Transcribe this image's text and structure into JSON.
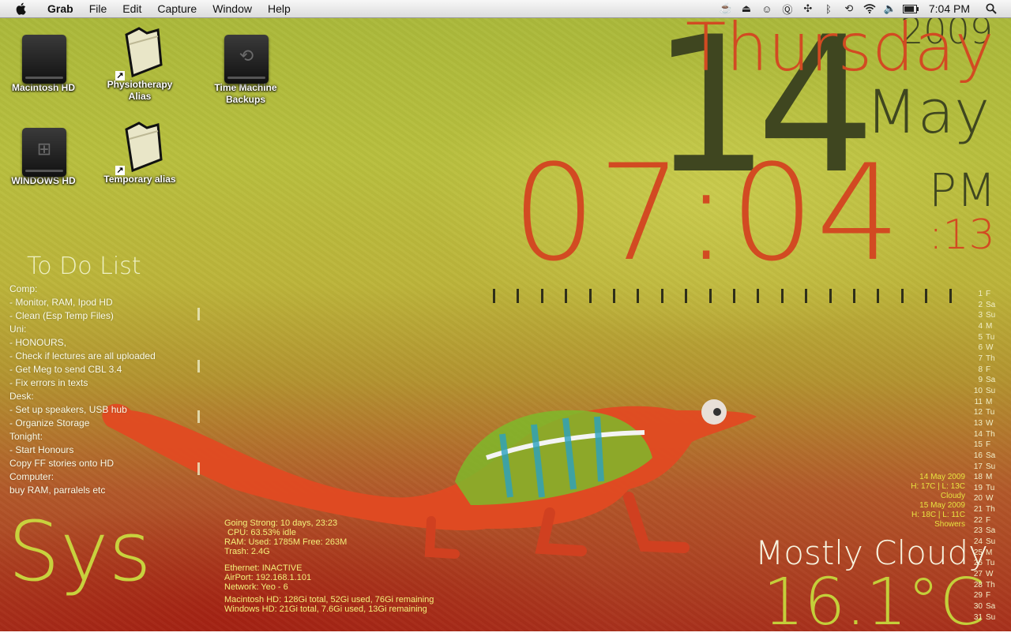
{
  "menubar": {
    "app_name": "Grab",
    "menus": [
      "File",
      "Edit",
      "Capture",
      "Window",
      "Help"
    ],
    "status_icons": [
      "coffee-cup-icon",
      "eject-icon",
      "finder-face-icon",
      "quicksilver-icon",
      "cross-arrows-icon",
      "bluetooth-like-icon",
      "time-machine-icon",
      "wifi-icon",
      "volume-icon",
      "battery-icon"
    ],
    "clock": "7:04 PM"
  },
  "desktop_icons": [
    {
      "label": "Macintosh HD",
      "kind": "drive",
      "emblem": ""
    },
    {
      "label": "Physiotherapy Alias",
      "kind": "folder-alias"
    },
    {
      "label": "Time Machine Backups",
      "kind": "drive",
      "emblem": "⟲"
    },
    {
      "label": "WINDOWS HD",
      "kind": "drive",
      "emblem": "⊞"
    },
    {
      "label": "Temporary alias",
      "kind": "folder-alias"
    }
  ],
  "clock_widget": {
    "day_number": "14",
    "weekday": "Thursday",
    "year": "2009",
    "month": "May",
    "time": "07:04",
    "ampm": "PM",
    "seconds": ":13"
  },
  "todo": {
    "title": "To Do List",
    "lines": [
      "Comp:",
      "- Monitor, RAM, Ipod HD",
      "- Clean (Esp Temp Files)",
      "Uni:",
      "- HONOURS,",
      "- Check if lectures are all uploaded",
      "- Get Meg to send CBL 3.4",
      "- Fix errors in texts",
      "Desk:",
      "- Set up speakers, USB hub",
      "- Organize Storage",
      "Tonight:",
      "- Start Honours",
      "Copy FF stories onto HD",
      "Computer:",
      "buy RAM, parralels etc"
    ]
  },
  "sys": {
    "title": "Sys",
    "uptime": "Going Strong: 10 days, 23:23",
    "cpu": "CPU:  63.53% idle",
    "ram": "RAM:  Used: 1785M Free: 263M",
    "trash": "Trash: 2.4G",
    "ethernet": "Ethernet: INACTIVE",
    "airport": "AirPort: 192.168.1.101",
    "network": "Network: Yeo - 6",
    "mac_hd": "Macintosh HD: 128Gi total, 52Gi used, 76Gi remaining",
    "win_hd": "Windows HD: 21Gi total, 7.6Gi used, 13Gi remaining"
  },
  "weather": {
    "forecast": [
      "14 May 2009",
      "H: 17C | L: 13C",
      "Cloudy",
      "15 May 2009",
      "H: 18C | L: 11C",
      "Showers"
    ],
    "condition": "Mostly Cloudy",
    "temperature": "16.1°C"
  },
  "calendar": [
    [
      "1",
      "F"
    ],
    [
      "2",
      "Sa"
    ],
    [
      "3",
      "Su"
    ],
    [
      "4",
      "M"
    ],
    [
      "5",
      "Tu"
    ],
    [
      "6",
      "W"
    ],
    [
      "7",
      "Th"
    ],
    [
      "8",
      "F"
    ],
    [
      "9",
      "Sa"
    ],
    [
      "10",
      "Su"
    ],
    [
      "11",
      "M"
    ],
    [
      "12",
      "Tu"
    ],
    [
      "13",
      "W"
    ],
    [
      "14",
      "Th"
    ],
    [
      "15",
      "F"
    ],
    [
      "16",
      "Sa"
    ],
    [
      "17",
      "Su"
    ],
    [
      "18",
      "M"
    ],
    [
      "19",
      "Tu"
    ],
    [
      "20",
      "W"
    ],
    [
      "21",
      "Th"
    ],
    [
      "22",
      "F"
    ],
    [
      "23",
      "Sa"
    ],
    [
      "24",
      "Su"
    ],
    [
      "25",
      "M"
    ],
    [
      "26",
      "Tu"
    ],
    [
      "27",
      "W"
    ],
    [
      "28",
      "Th"
    ],
    [
      "29",
      "F"
    ],
    [
      "30",
      "Sa"
    ],
    [
      "31",
      "Su"
    ]
  ],
  "colors": {
    "accent_orange": "#d24a22",
    "dark_olive": "#3f4620",
    "sys_yellow": "#f4f07a"
  }
}
